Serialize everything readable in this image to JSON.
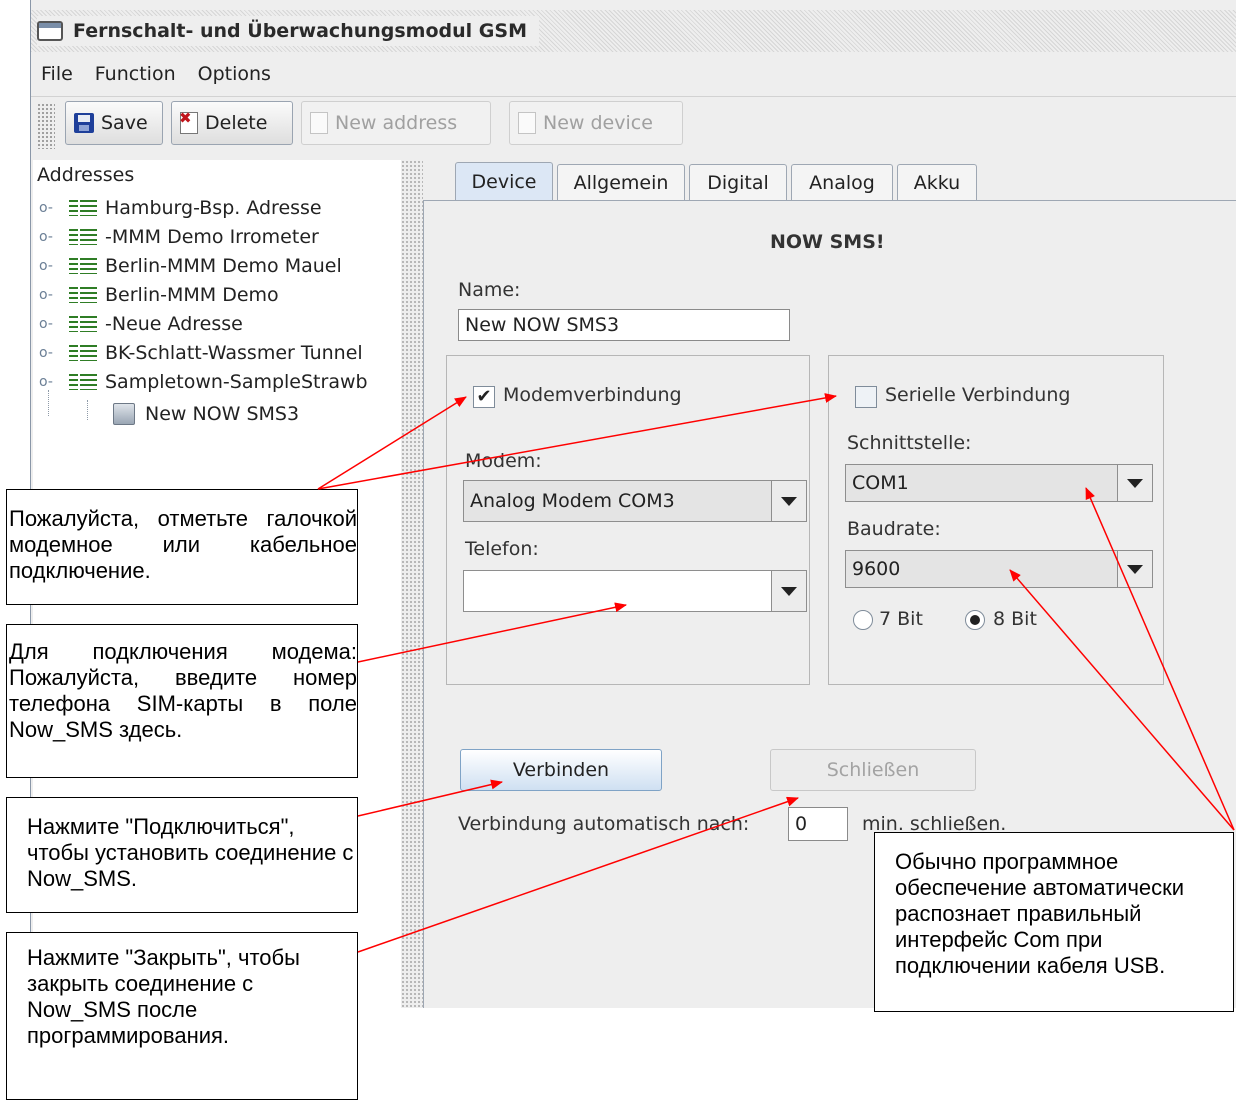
{
  "window": {
    "title": "Fernschalt- und Überwachungsmodul GSM"
  },
  "menu": [
    "File",
    "Function",
    "Options"
  ],
  "toolbar": {
    "save": "Save",
    "delete": "Delete",
    "new_address": "New address",
    "new_device": "New device"
  },
  "tree": {
    "root": "Addresses",
    "items": [
      "Hamburg-Bsp. Adresse",
      "-MMM Demo Irrometer",
      "Berlin-MMM Demo Mauel",
      "Berlin-MMM Demo",
      "-Neue Adresse",
      "BK-Schlatt-Wassmer Tunnel",
      "Sampletown-SampleStrawb"
    ],
    "child": "New NOW SMS3"
  },
  "tabs": [
    "Device",
    "Allgemein",
    "Digital",
    "Analog",
    "Akku"
  ],
  "device": {
    "heading": "NOW SMS!",
    "name_label": "Name:",
    "name_value": "New NOW SMS3",
    "modem": {
      "checkbox_label": "Modemverbindung",
      "checked": true,
      "modem_label": "Modem:",
      "modem_value": "Analog Modem COM3",
      "telefon_label": "Telefon:",
      "telefon_value": ""
    },
    "serial": {
      "checkbox_label": "Serielle Verbindung",
      "checked": false,
      "schnittstelle_label": "Schnittstelle:",
      "schnittstelle_value": "COM1",
      "baudrate_label": "Baudrate:",
      "baudrate_value": "9600",
      "bit7": "7 Bit",
      "bit8": "8 Bit",
      "selected_bits": "8 Bit"
    },
    "connect_button": "Verbinden",
    "close_button": "Schließen",
    "auto_close_prefix": "Verbindung automatisch nach:",
    "auto_close_value": "0",
    "auto_close_suffix": "min. schließen."
  },
  "callouts": {
    "check": "Пожалуйста, отметьте галочкой модемное или кабельное подключение.",
    "phone": "Для подключения модема: Пожалуйста, введите номер телефона SIM-карты в поле Now_SMS здесь.",
    "connect": "Нажмите \"Подключиться\", чтобы установить соединение с Now_SMS.",
    "close": "Нажмите \"Закрыть\", чтобы закрыть соединение с Now_SMS после программирования.",
    "com": "Обычно программное обеспечение автоматически распознает правильный интерфейс Com при подключении кабеля USB."
  },
  "colors": {
    "arrow": "#ff0000",
    "active_tab": "#dce7f5",
    "button_grad_end": "#cfe0f2"
  }
}
